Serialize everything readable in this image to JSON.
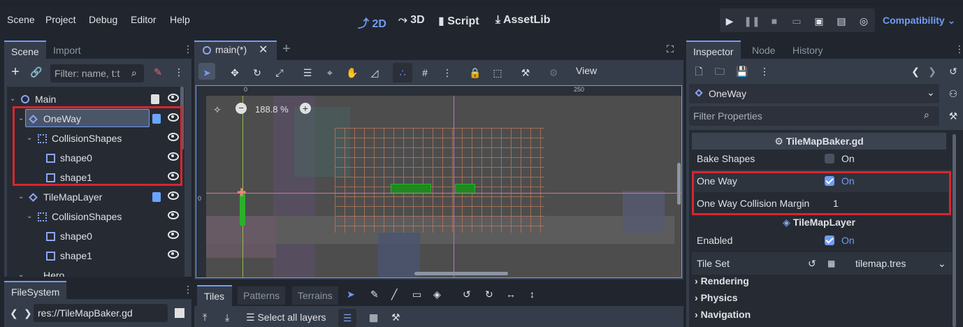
{
  "menu": [
    "Scene",
    "Project",
    "Debug",
    "Editor",
    "Help"
  ],
  "workspaces": [
    {
      "label": "2D",
      "icon": "2d-icon",
      "active": true
    },
    {
      "label": "3D",
      "icon": "3d-icon",
      "active": false
    },
    {
      "label": "Script",
      "icon": "script-icon",
      "active": false
    },
    {
      "label": "AssetLib",
      "icon": "assetlib-icon",
      "active": false
    }
  ],
  "renderer": "Compatibility",
  "scene_dock": {
    "tabs": [
      "Scene",
      "Import"
    ],
    "filter_placeholder": "Filter: name, t:t",
    "tree": [
      {
        "label": "Main"
      },
      {
        "label": "OneWay"
      },
      {
        "label": "CollisionShapes"
      },
      {
        "label": "shape0"
      },
      {
        "label": "shape1"
      },
      {
        "label": "TileMapLayer"
      },
      {
        "label": "CollisionShapes"
      },
      {
        "label": "shape0"
      },
      {
        "label": "shape1"
      },
      {
        "label": "Hero"
      }
    ]
  },
  "filesystem": {
    "tab": "FileSystem",
    "path": "res://TileMapBaker.gd"
  },
  "editor": {
    "tab_label": "main(*)",
    "view_label": "View",
    "zoom": "188.8 %",
    "ruler_labels": [
      "0",
      "250",
      "0"
    ]
  },
  "bottom_panel": {
    "tabs": [
      "Tiles",
      "Patterns",
      "Terrains"
    ],
    "select_all_layers": "Select all layers"
  },
  "inspector": {
    "tabs": [
      "Inspector",
      "Node",
      "History"
    ],
    "node_name": "OneWay",
    "filter_placeholder": "Filter Properties",
    "section1": "TileMapBaker.gd",
    "bake_shapes": {
      "label": "Bake Shapes",
      "value": "On"
    },
    "one_way": {
      "label": "One Way",
      "value": "On"
    },
    "one_way_margin": {
      "label": "One Way Collision Margin",
      "value": "1"
    },
    "section2": "TileMapLayer",
    "enabled": {
      "label": "Enabled",
      "value": "On"
    },
    "tile_set": {
      "label": "Tile Set",
      "value": "tilemap.tres"
    },
    "groups": [
      "Rendering",
      "Physics",
      "Navigation"
    ]
  },
  "colors": {
    "accent": "#709cf5",
    "highlight": "#d9252d",
    "panel": "#363d4a",
    "bg": "#21262e"
  }
}
